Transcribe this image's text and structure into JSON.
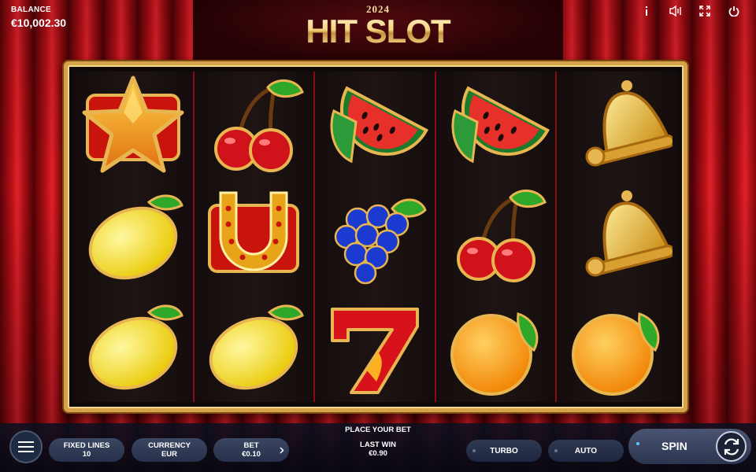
{
  "header": {
    "balance_label": "BALANCE",
    "balance_value": "€10,002.30",
    "logo_year": "2024",
    "logo_title": "HIT SLOT",
    "icons": [
      "info-icon",
      "sound-icon",
      "fullscreen-icon",
      "power-icon"
    ]
  },
  "reels": [
    [
      "star",
      "lemon",
      "lemon"
    ],
    [
      "cherry",
      "horseshoe",
      "lemon"
    ],
    [
      "watermelon",
      "grapes",
      "seven"
    ],
    [
      "watermelon",
      "cherry",
      "orange"
    ],
    [
      "bell",
      "bell",
      "orange"
    ]
  ],
  "controls": {
    "place_bet": "PLACE YOUR BET",
    "fixed_lines_label": "FIXED LINES",
    "fixed_lines_value": "10",
    "currency_label": "CURRENCY",
    "currency_value": "EUR",
    "bet_label": "BET",
    "bet_value": "€0.10",
    "last_win_label": "LAST WIN",
    "last_win_value": "€0.90",
    "turbo_label": "TURBO",
    "auto_label": "AUTO",
    "spin_label": "SPIN"
  },
  "colors": {
    "frame_gold": "#d6a24a",
    "curtain_red": "#b30f16",
    "bar_dark": "#0a1020"
  }
}
